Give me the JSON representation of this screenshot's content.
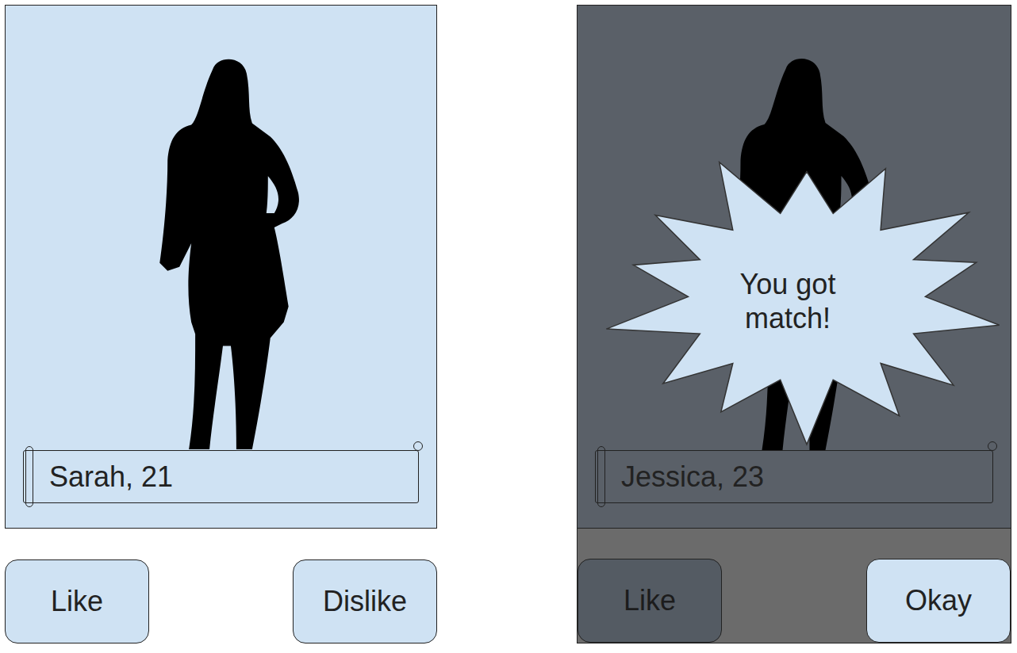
{
  "left_screen": {
    "card_caption": "Sarah, 21",
    "buttons": [
      {
        "label": "Like",
        "dimmed": false
      },
      {
        "label": "Dislike",
        "dimmed": false
      }
    ]
  },
  "right_screen": {
    "card_caption": "Jessica, 23",
    "match_popup": {
      "text": "You got match!"
    },
    "buttons": [
      {
        "label": "Like",
        "dimmed": true
      },
      {
        "label": "Okay",
        "dimmed": false
      }
    ]
  }
}
